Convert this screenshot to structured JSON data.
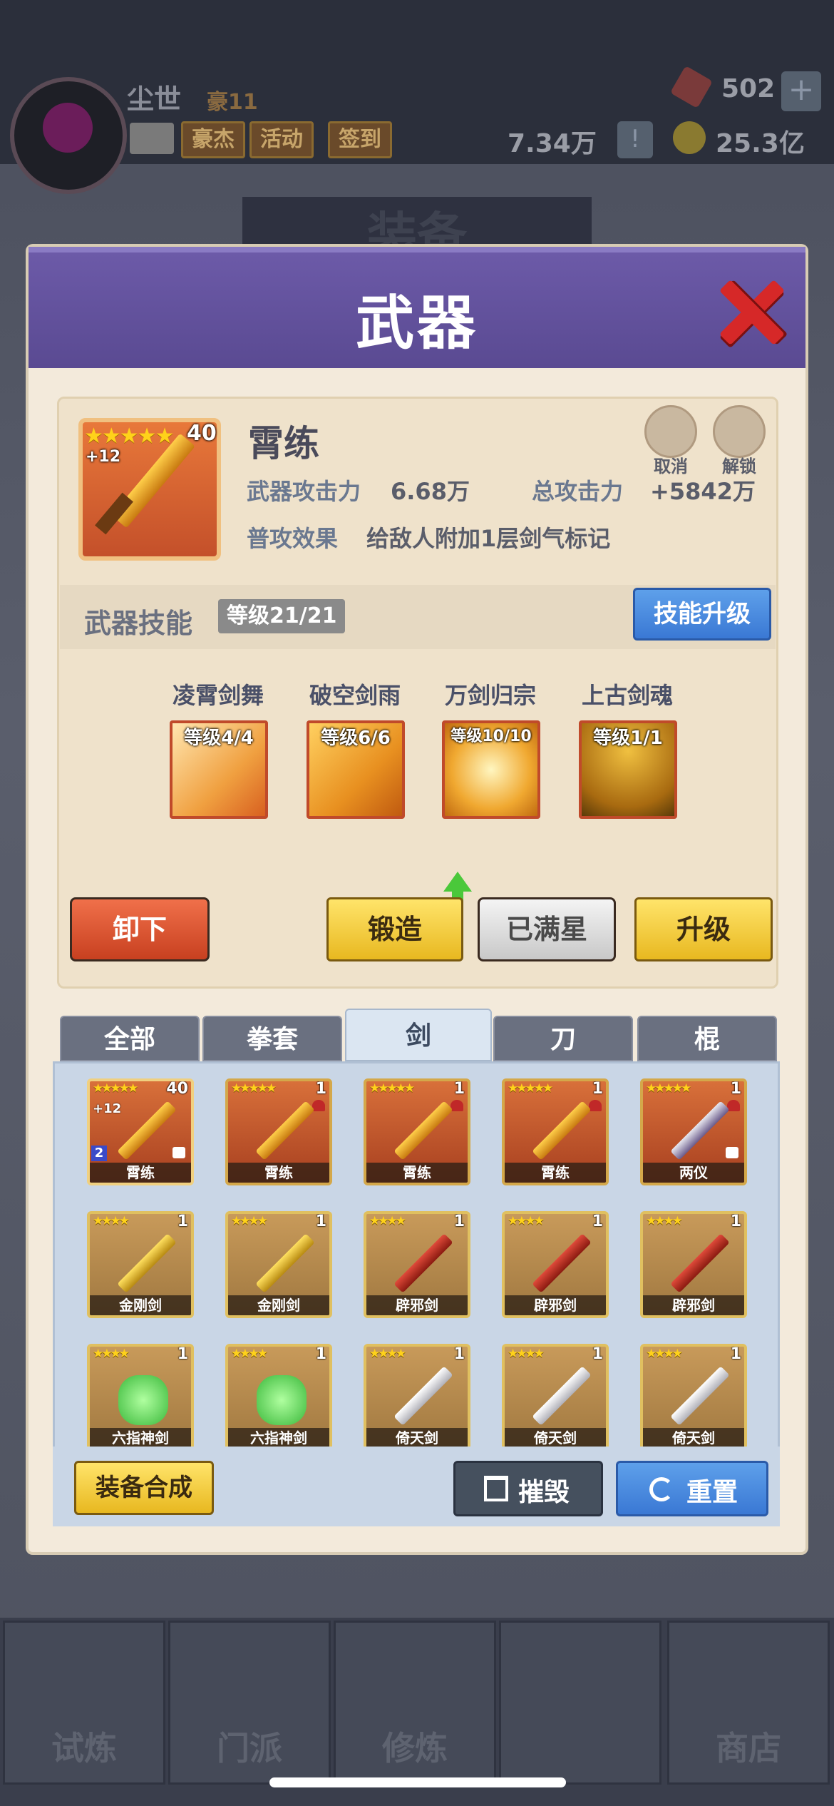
{
  "player": {
    "name": "尘世",
    "vip": "豪11",
    "tags": [
      "豪杰",
      "活动",
      "签到"
    ]
  },
  "resources": {
    "gems": "502",
    "power": "7.34万",
    "coins": "25.3亿",
    "plus": "+",
    "info": "!"
  },
  "background": {
    "title": "装备",
    "nav": [
      "试炼",
      "门派",
      "修炼",
      "",
      "商店"
    ]
  },
  "modal": {
    "title": "武器",
    "item": {
      "name": "霄练",
      "stars": "★★★★★",
      "level": "40",
      "plus": "+12",
      "attack_label": "武器攻击力",
      "attack_value": "6.68万",
      "total_label": "总攻击力",
      "total_value": "+5842万",
      "effect_label": "普攻效果",
      "effect_value": "给敌人附加1层剑气标记",
      "cancel_label": "取消",
      "unlock_label": "解锁"
    },
    "skills": {
      "title": "武器技能",
      "level": "等级21/21",
      "upgrade_label": "技能升级",
      "list": [
        {
          "name": "凌霄剑舞",
          "level": "等级4/4"
        },
        {
          "name": "破空剑雨",
          "level": "等级6/6"
        },
        {
          "name": "万剑归宗",
          "level": "等级10/10"
        },
        {
          "name": "上古剑魂",
          "level": "等级1/1"
        }
      ]
    },
    "actions": {
      "unequip": "卸下",
      "forge": "锻造",
      "max_star": "已满星",
      "upgrade": "升级"
    },
    "tabs": [
      "全部",
      "拳套",
      "剑",
      "刀",
      "棍"
    ],
    "inventory": [
      {
        "name": "霄练",
        "stars": "★★★★★",
        "level": "40",
        "plus": "+12",
        "count": "2"
      },
      {
        "name": "霄练",
        "stars": "★★★★★",
        "level": "1"
      },
      {
        "name": "霄练",
        "stars": "★★★★★",
        "level": "1"
      },
      {
        "name": "霄练",
        "stars": "★★★★★",
        "level": "1"
      },
      {
        "name": "两仪",
        "stars": "★★★★★",
        "level": "1"
      },
      {
        "name": "金刚剑",
        "stars": "★★★★",
        "level": "1"
      },
      {
        "name": "金刚剑",
        "stars": "★★★★",
        "level": "1"
      },
      {
        "name": "辟邪剑",
        "stars": "★★★★",
        "level": "1"
      },
      {
        "name": "辟邪剑",
        "stars": "★★★★",
        "level": "1"
      },
      {
        "name": "辟邪剑",
        "stars": "★★★★",
        "level": "1"
      },
      {
        "name": "六指神剑",
        "stars": "★★★★",
        "level": "1"
      },
      {
        "name": "六指神剑",
        "stars": "★★★★",
        "level": "1"
      },
      {
        "name": "倚天剑",
        "stars": "★★★★",
        "level": "1"
      },
      {
        "name": "倚天剑",
        "stars": "★★★★",
        "level": "1"
      },
      {
        "name": "倚天剑",
        "stars": "★★★★",
        "level": "1"
      }
    ],
    "footer": {
      "combine": "装备合成",
      "destroy": "摧毁",
      "reset": "重置"
    }
  }
}
